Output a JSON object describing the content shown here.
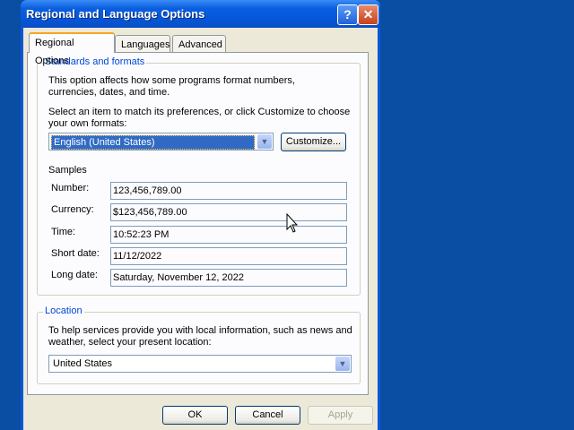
{
  "window": {
    "title": "Regional and Language Options",
    "help_label": "?",
    "close_label": "✕"
  },
  "tabs": [
    {
      "label": "Regional Options",
      "active": true
    },
    {
      "label": "Languages",
      "active": false
    },
    {
      "label": "Advanced",
      "active": false
    }
  ],
  "standards": {
    "legend": "Standards and formats",
    "description": "This option affects how some programs format numbers, currencies, dates, and time.",
    "instruction": "Select an item to match its preferences, or click Customize to choose your own formats:",
    "format_selected": "English (United States)",
    "customize_label": "Customize...",
    "samples_label": "Samples",
    "samples": [
      {
        "label": "Number:",
        "value": "123,456,789.00"
      },
      {
        "label": "Currency:",
        "value": "$123,456,789.00"
      },
      {
        "label": "Time:",
        "value": "10:52:23 PM"
      },
      {
        "label": "Short date:",
        "value": "11/12/2022"
      },
      {
        "label": "Long date:",
        "value": "Saturday, November 12, 2022"
      }
    ]
  },
  "location": {
    "legend": "Location",
    "description": "To help services provide you with local information, such as news and weather, select your present location:",
    "selected": "United States"
  },
  "buttons": {
    "ok": "OK",
    "cancel": "Cancel",
    "apply": "Apply"
  },
  "colors": {
    "desktop": "#0a4ea3",
    "titlebar": "#0556d8",
    "legend_text": "#0046d5",
    "selection": "#316ac5"
  }
}
